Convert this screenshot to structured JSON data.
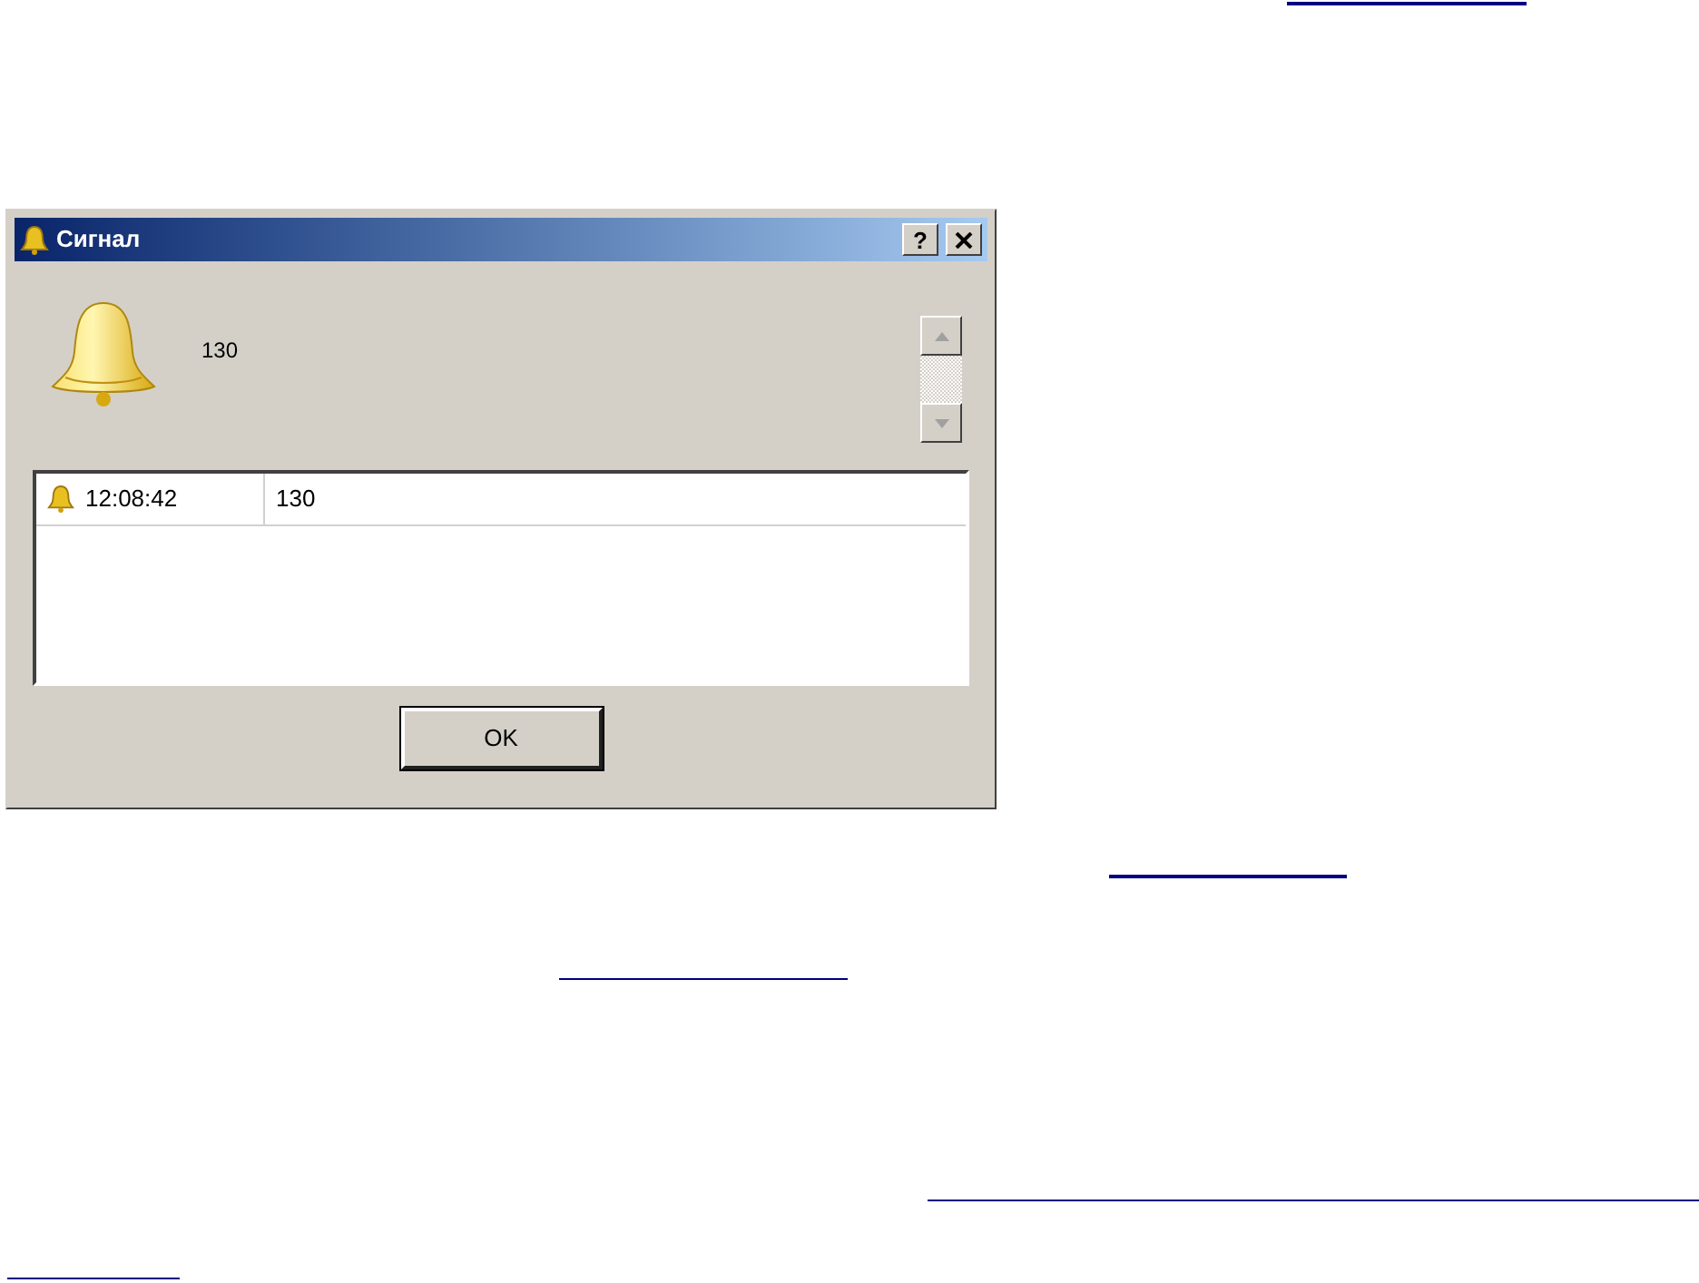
{
  "window": {
    "title": "Сигнал",
    "help_button": "?"
  },
  "message": "130",
  "alerts": [
    {
      "time": "12:08:42",
      "text": "130"
    }
  ],
  "buttons": [
    "OK"
  ]
}
